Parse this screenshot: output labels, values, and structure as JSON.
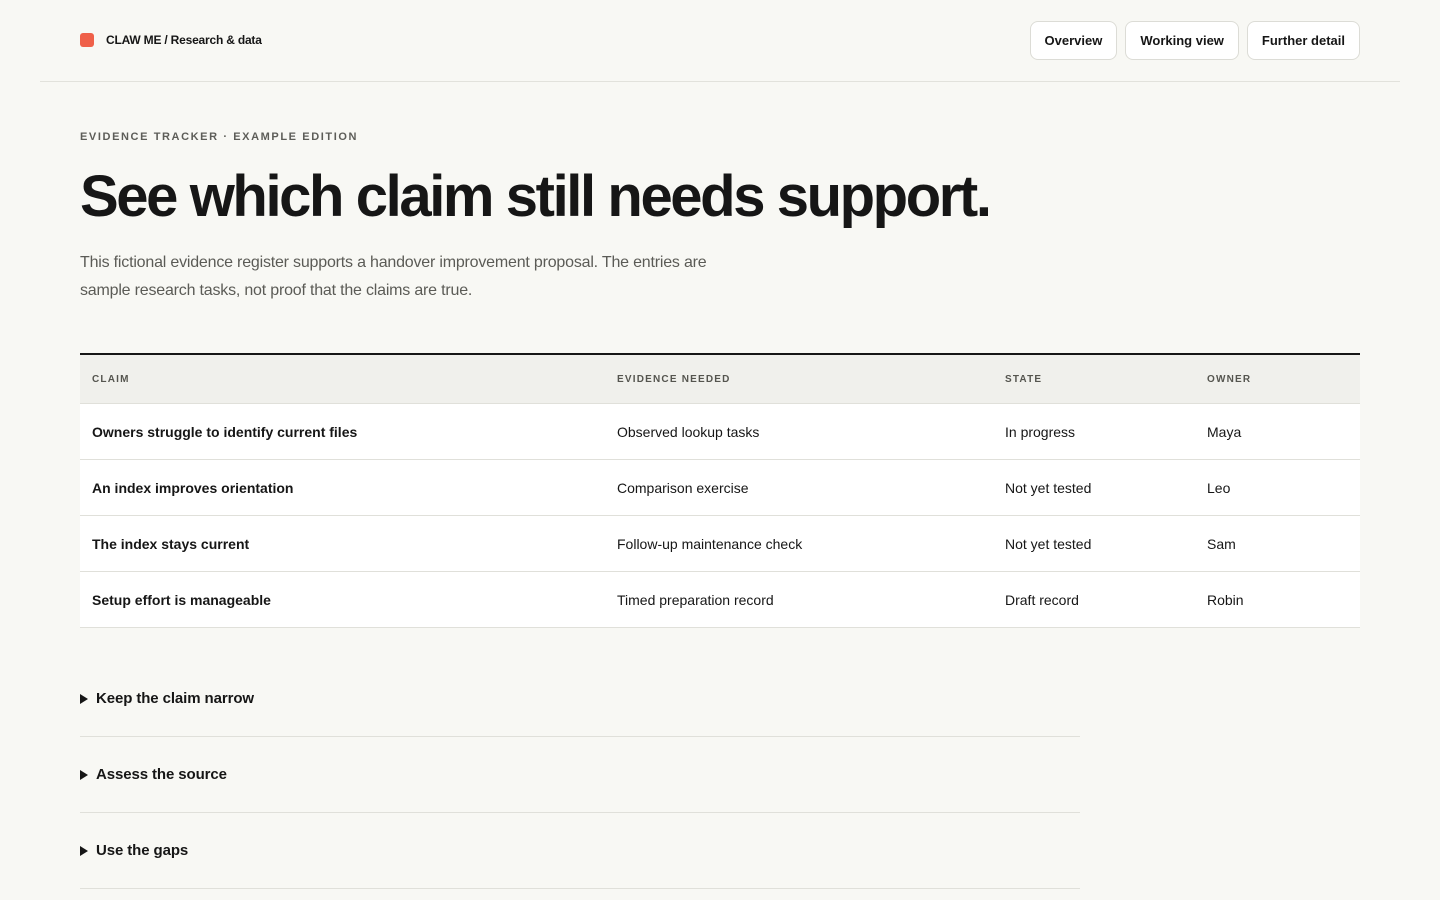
{
  "header": {
    "brand": "CLAW ME / Research & data",
    "brand_color": "#ef6049",
    "nav": [
      {
        "label": "Overview"
      },
      {
        "label": "Working view"
      },
      {
        "label": "Further detail"
      }
    ]
  },
  "hero": {
    "eyebrow": "EVIDENCE TRACKER · EXAMPLE EDITION",
    "title": "See which claim still needs support.",
    "lede": "This fictional evidence register supports a handover improvement proposal. The entries are sample research tasks, not proof that the claims are true."
  },
  "table": {
    "columns": [
      "CLAIM",
      "EVIDENCE NEEDED",
      "STATE",
      "OWNER"
    ],
    "rows": [
      {
        "claim": "Owners struggle to identify current files",
        "evidence": "Observed lookup tasks",
        "state": "In progress",
        "owner": "Maya"
      },
      {
        "claim": "An index improves orientation",
        "evidence": "Comparison exercise",
        "state": "Not yet tested",
        "owner": "Leo"
      },
      {
        "claim": "The index stays current",
        "evidence": "Follow-up maintenance check",
        "state": "Not yet tested",
        "owner": "Sam"
      },
      {
        "claim": "Setup effort is manageable",
        "evidence": "Timed preparation record",
        "state": "Draft record",
        "owner": "Robin"
      }
    ]
  },
  "details": [
    {
      "label": "Keep the claim narrow"
    },
    {
      "label": "Assess the source"
    },
    {
      "label": "Use the gaps"
    }
  ]
}
